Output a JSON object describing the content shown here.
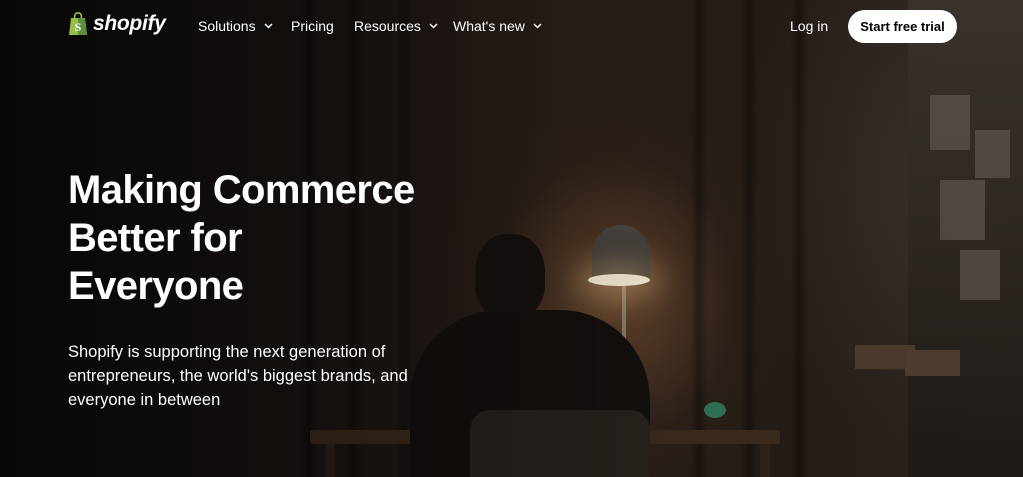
{
  "brand": {
    "name": "shopify",
    "color": "#95bf47"
  },
  "nav": {
    "items": [
      {
        "label": "Solutions",
        "has_dropdown": true
      },
      {
        "label": "Pricing",
        "has_dropdown": false
      },
      {
        "label": "Resources",
        "has_dropdown": true
      },
      {
        "label": "What's new",
        "has_dropdown": true
      }
    ],
    "login_label": "Log in",
    "cta_label": "Start free trial"
  },
  "hero": {
    "headline_lines": [
      "Making Commerce",
      "Better for",
      "Everyone"
    ],
    "subtext_lines": [
      "Shopify is supporting the next generation of",
      "entrepreneurs, the world's biggest brands, and",
      "everyone in between"
    ]
  }
}
